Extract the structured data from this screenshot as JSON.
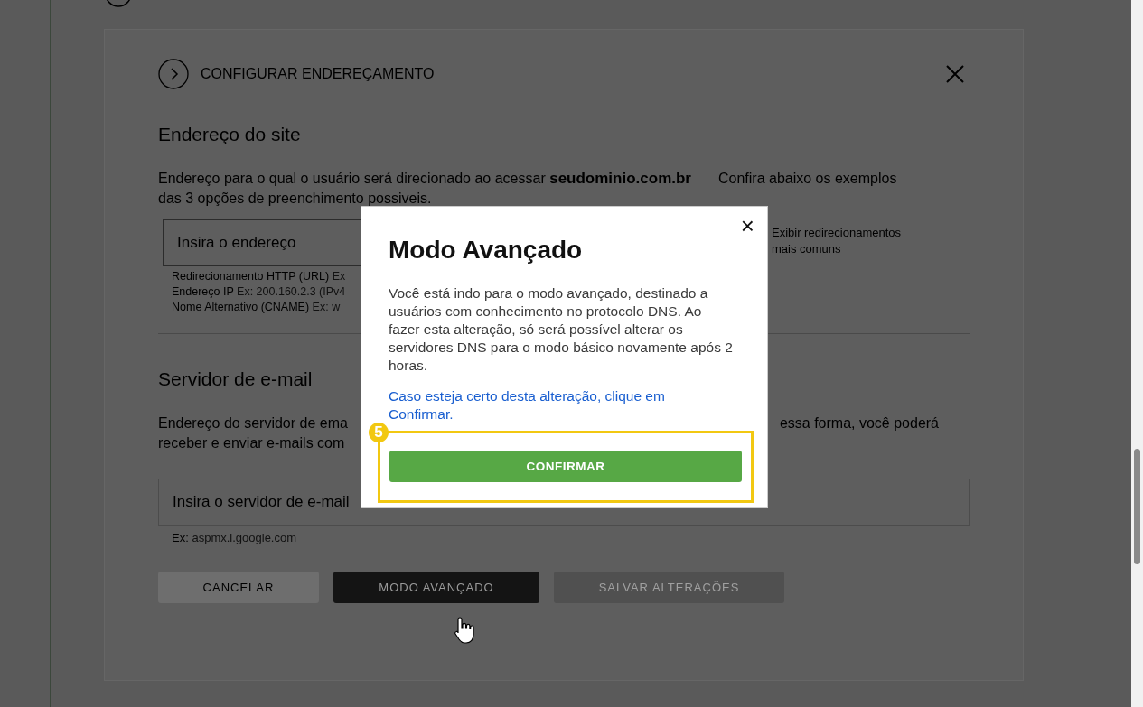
{
  "background_page": {
    "header": {
      "title": "CONFIGURAR ENDEREÇAMENTO"
    },
    "site_address": {
      "heading": "Endereço do site",
      "description": "Endereço para o qual o usuário será direcionado ao acessar **seudominio.com.br**",
      "description_tail": "Confira abaixo os exemplos das 3 opções de preenchimento possiveis.",
      "field": {
        "placeholder": "Insira o endereço"
      },
      "hints": [
        {
          "label": "Redirecionamento HTTP (URL)",
          "example": "Ex"
        },
        {
          "label": "Endereço IP",
          "example": "Ex: 200.160.2.3 (IPv4"
        },
        {
          "label": "Nome Alternativo (CNAME)",
          "example": "Ex: w"
        }
      ],
      "link": "Exibir redirecionamentos mais comuns"
    },
    "email_server": {
      "heading": "Servidor de e-mail",
      "fragments_left": [
        "Endereço do servidor de ema",
        "receber e enviar e-mails com"
      ],
      "fragment_right": "essa forma, você poderá",
      "field": {
        "placeholder": "Insira o servidor de e-mail"
      },
      "hint": {
        "label": "Ex:",
        "example": "aspmx.l.google.com"
      }
    },
    "buttons": [
      {
        "label": "CANCELAR",
        "kind": "secondary"
      },
      {
        "label": "MODO AVANÇADO",
        "kind": "dark"
      },
      {
        "label": "SALVAR ALTERAÇÕES",
        "kind": "disabled"
      }
    ]
  },
  "modal": {
    "close": "×",
    "title": "Modo Avançado",
    "body": "Você está indo para o modo avançado, destinado a usuários com conhecimento no protocolo DNS. Ao fazer esta alteração, só será possível alterar os servidores DNS para o modo básico novamente após 2 horas.",
    "link": "Caso esteja certo desta alteração, clique em Confirmar.",
    "step_badge": "5",
    "confirm": "CONFIRMAR"
  }
}
